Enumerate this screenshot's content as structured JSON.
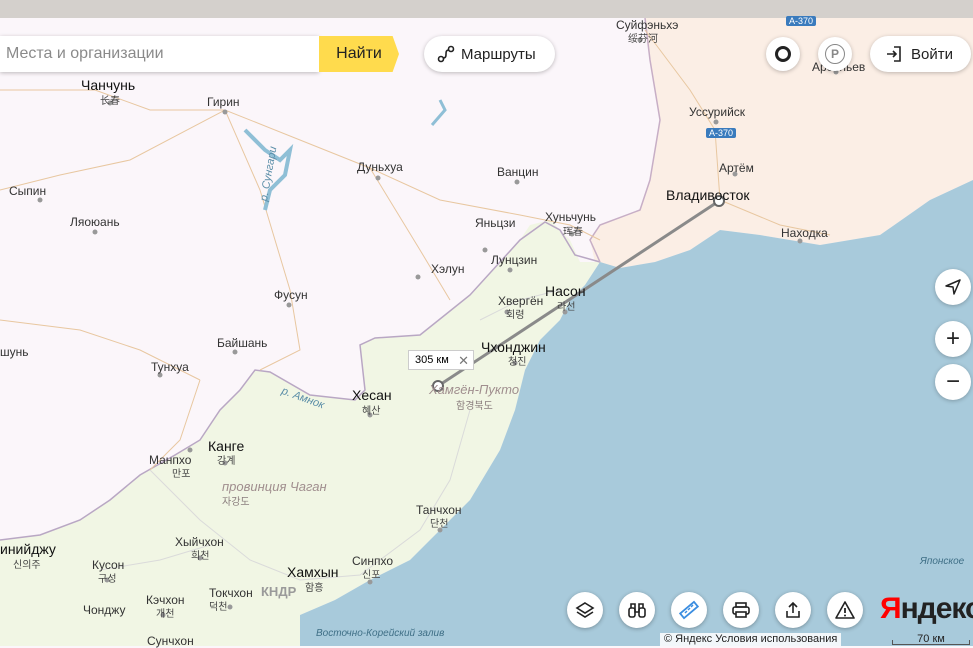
{
  "search": {
    "placeholder": "Места и организации",
    "button_label": "Найти"
  },
  "header": {
    "routes_label": "Маршруты",
    "login_label": "Войти"
  },
  "ruler": {
    "distance_label": "305 км"
  },
  "footer": {
    "copyright": "© Яндекс Условия использования",
    "scale": "70 км",
    "logo_first": "Я",
    "logo_rest": "ндекс"
  },
  "places": {
    "changchun": "Чанчунь",
    "changchun_han": "长春",
    "girin": "Гирин",
    "sypin": "Сыпин",
    "lyaoyuan": "Ляоюань",
    "dunhua": "Дуньхуа",
    "vantsin": "Ванцин",
    "yantszi": "Яньцзи",
    "hunchun": "Хуньчунь",
    "hunchun_han": "珲春",
    "lunzin": "Лунцзин",
    "helun": "Хэлун",
    "fusun": "Фусун",
    "baishan": "Байшань",
    "tunhua": "Тунхуа",
    "shun": "шунь",
    "hvergen": "Хвергён",
    "hvergen_han": "회령",
    "nason": "Насон",
    "nason_han": "라선",
    "chhondzhin": "Чхонджин",
    "chhondzhin_han": "청진",
    "heshan": "Хесан",
    "heshan_han": "혜산",
    "kange": "Канге",
    "kange_han": "강계",
    "manpho": "Манпхо",
    "manpho_han": "만포",
    "tanchon": "Танчхон",
    "tanchon_han": "단천",
    "hamhyn": "Хамхын",
    "hamhyn_han": "함흥",
    "sinpho": "Синпхо",
    "sinpho_han": "신포",
    "hyichhon": "Хыйчхон",
    "hyichhon_han": "희천",
    "kuson": "Кусон",
    "kuson_han": "구성",
    "kechhon": "Кэчхон",
    "kechhon_han": "개천",
    "tokchhon": "Токчхон",
    "tokchhon_han": "덕천",
    "chondzhu": "Чонджу",
    "sunchhon": "Сунчхон",
    "sinyidzhu": "инийджу",
    "sinyidzhu_han": "신의주",
    "suifenhe": "Суйфэньхэ",
    "suifenhe_han": "绥芬河",
    "arsenev": "Арсеньев",
    "ussuriysk": "Уссурийск",
    "artem": "Артём",
    "vladivostok": "Владивосток",
    "nahodka": "Находка"
  },
  "regions": {
    "hamgyon": "Хамгён-Пукто",
    "hamgyon_han": "함경북도",
    "chagan": "провинция Чаган",
    "chagan_han": "자강도",
    "kndr": "КНДР"
  },
  "rivers": {
    "sungari": "р. Сунгари",
    "amnok": "р. Амнок"
  },
  "seas": {
    "japan": "Японское",
    "east_korea": "Восточно-Корейский залив"
  },
  "roads": {
    "a370_top": "А-370",
    "a370": "А-370"
  },
  "colors": {
    "china": "#fbf6fa",
    "korea": "#f1f6e4",
    "russia": "#fbeee5",
    "sea": "#a8cadb",
    "accent": "#ffdb4d"
  }
}
